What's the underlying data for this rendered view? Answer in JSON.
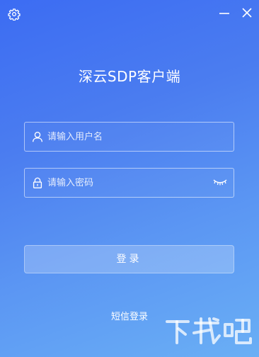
{
  "window": {
    "title": "深云SDP客户端",
    "settings_icon": "gear-icon",
    "minimize_icon": "minimize-icon",
    "close_icon": "close-icon"
  },
  "login_form": {
    "username": {
      "placeholder": "请输入用户名",
      "value": "",
      "icon": "user-icon"
    },
    "password": {
      "placeholder": "请输入密码",
      "value": "",
      "icon": "lock-icon",
      "toggle_icon": "eye-closed-icon"
    },
    "login_button_label": "登录",
    "sms_login_label": "短信登录"
  },
  "colors": {
    "gradient_top": "#3c6cf3",
    "gradient_bottom": "#6aaff5",
    "text": "#ffffff"
  },
  "watermark": {
    "text": "下载吧"
  }
}
